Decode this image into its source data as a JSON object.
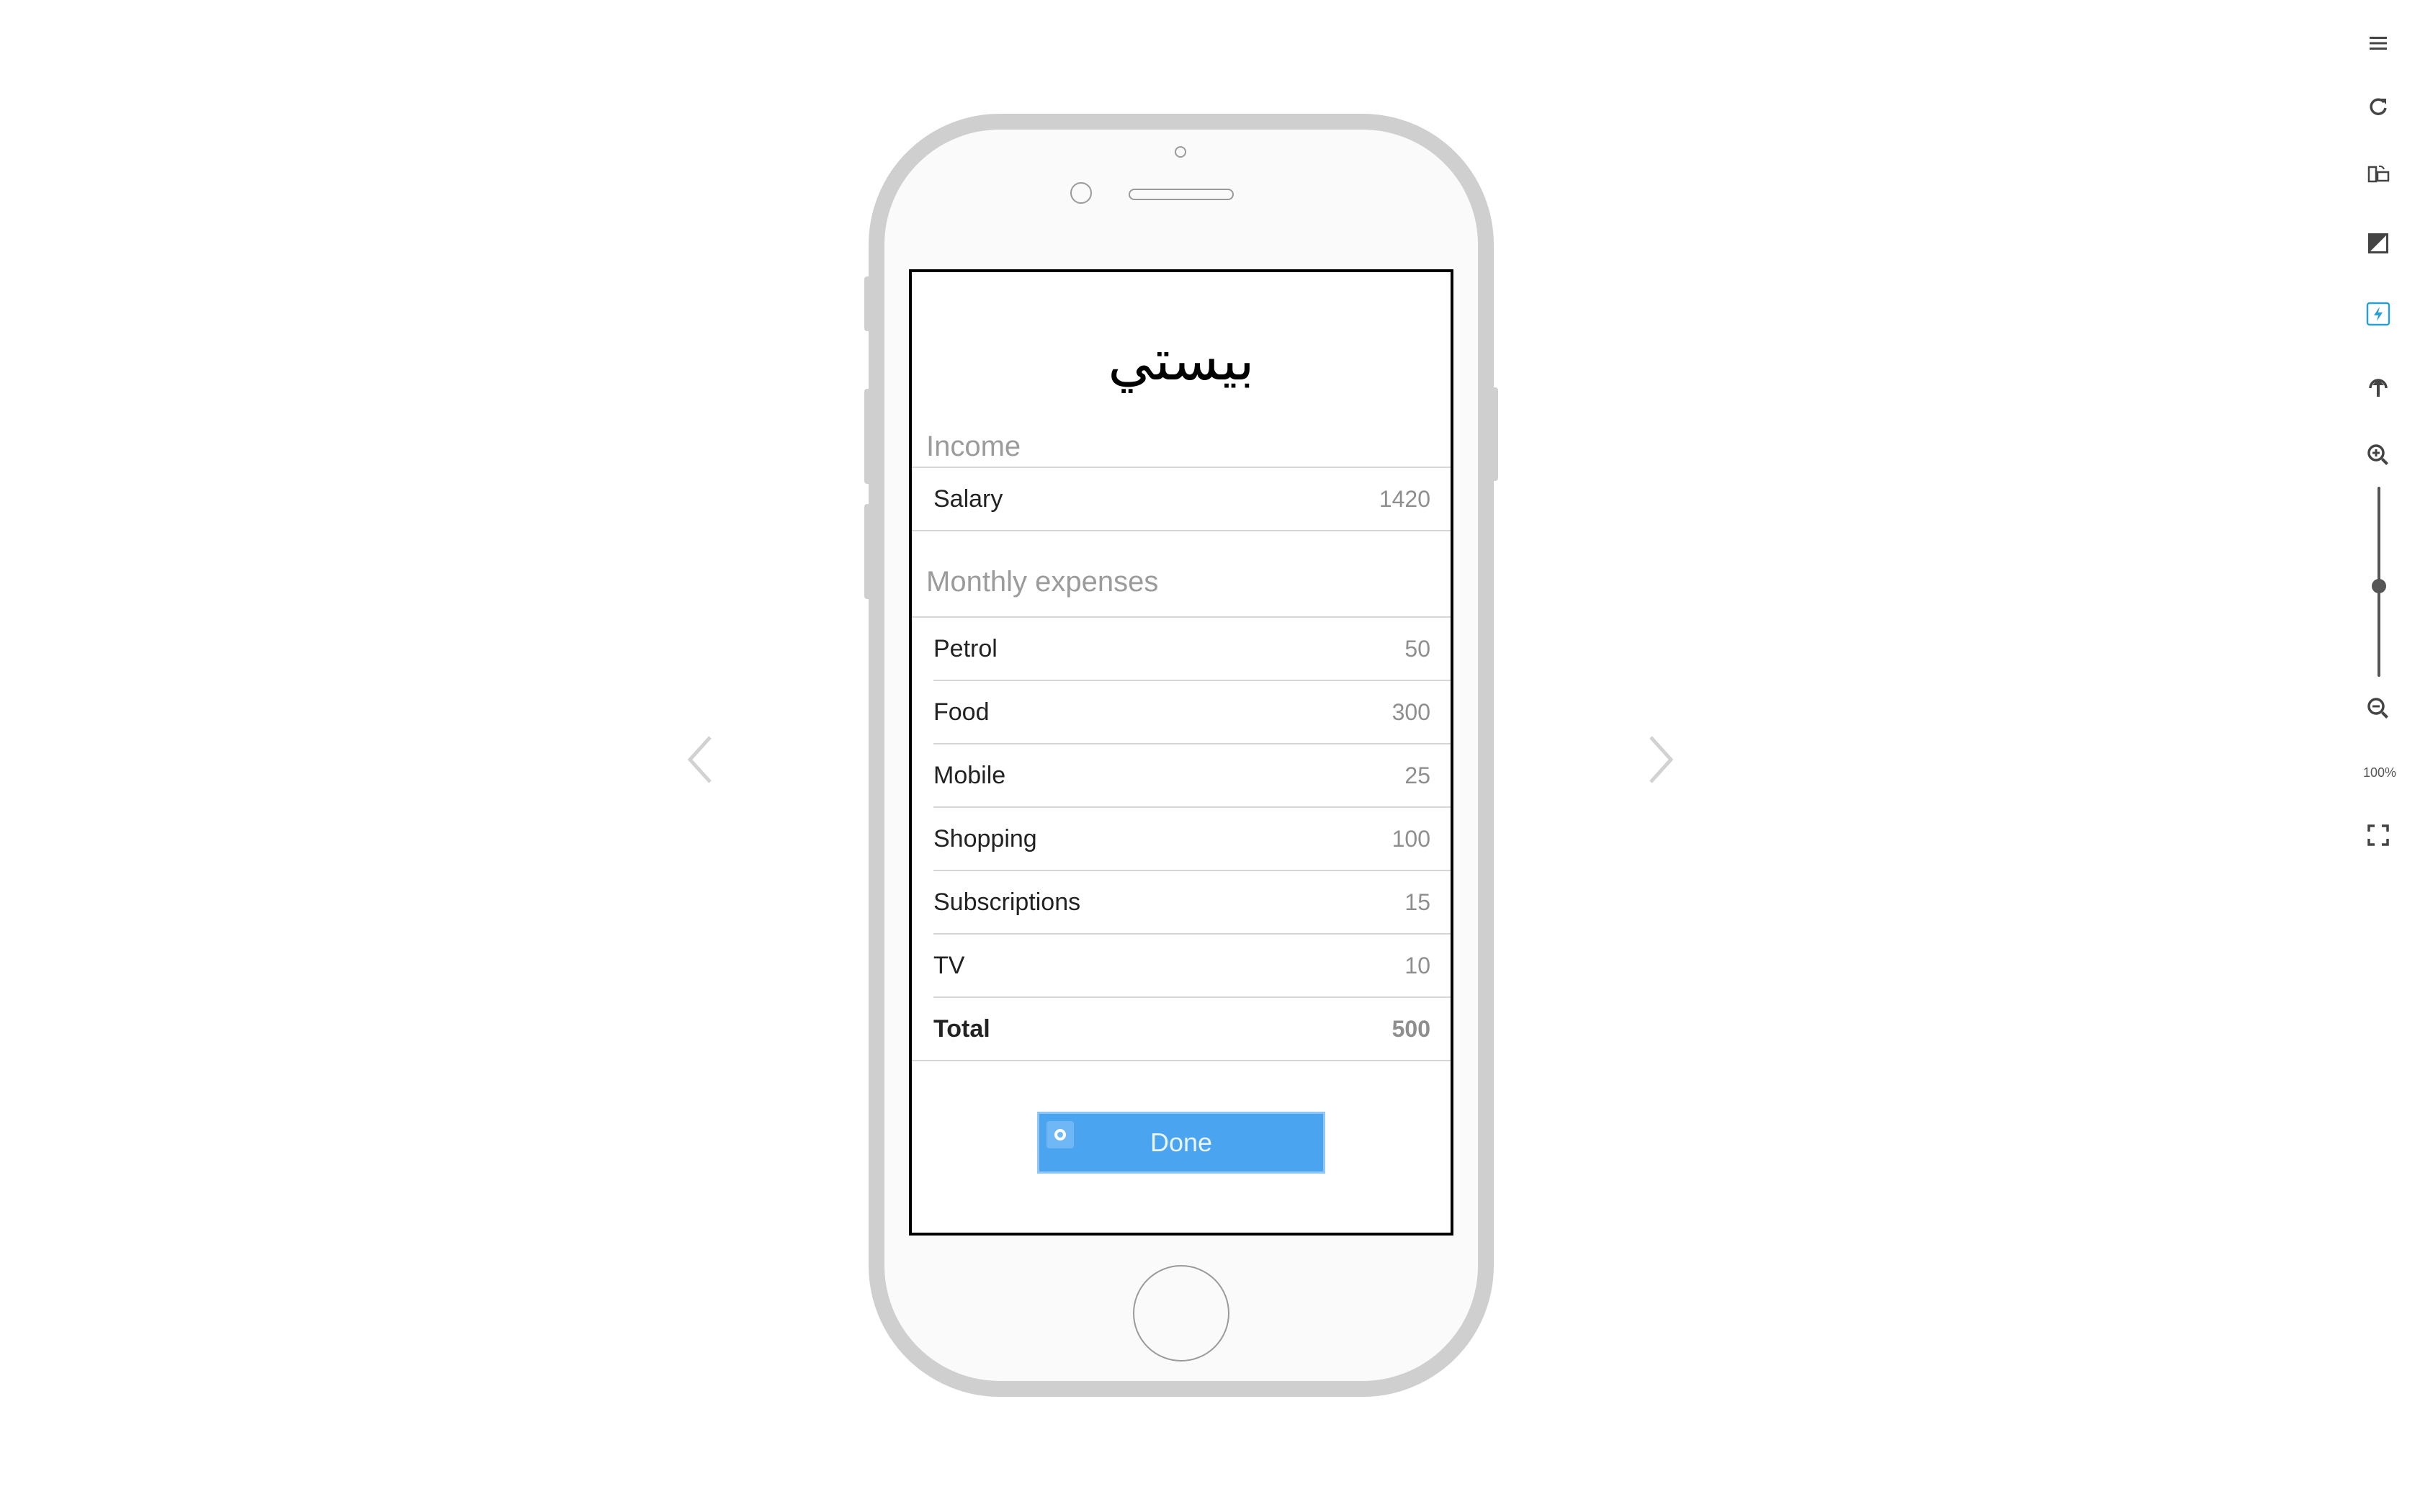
{
  "app": {
    "title": "بيستي"
  },
  "income": {
    "header": "Income",
    "rows": [
      {
        "label": "Salary",
        "value": "1420"
      }
    ]
  },
  "expenses": {
    "header": "Monthly expenses",
    "rows": [
      {
        "label": "Petrol",
        "value": "50"
      },
      {
        "label": "Food",
        "value": "300"
      },
      {
        "label": "Mobile",
        "value": "25"
      },
      {
        "label": "Shopping",
        "value": "100"
      },
      {
        "label": "Subscriptions",
        "value": "15"
      },
      {
        "label": "TV",
        "value": "10"
      }
    ],
    "total": {
      "label": "Total",
      "value": "500"
    }
  },
  "done_button": {
    "label": "Done"
  },
  "toolbar": {
    "icons": [
      "menu-icon",
      "refresh-icon",
      "rotate-device-icon",
      "contrast-icon",
      "hotspot-icon",
      "upload-icon",
      "zoom-in-icon",
      "zoom-out-icon",
      "fullscreen-icon"
    ],
    "zoom_label": "100%",
    "accent": "#2a9fd6"
  },
  "colors": {
    "button": "#4aa4ef",
    "phone_frame": "#cfcfcf"
  }
}
